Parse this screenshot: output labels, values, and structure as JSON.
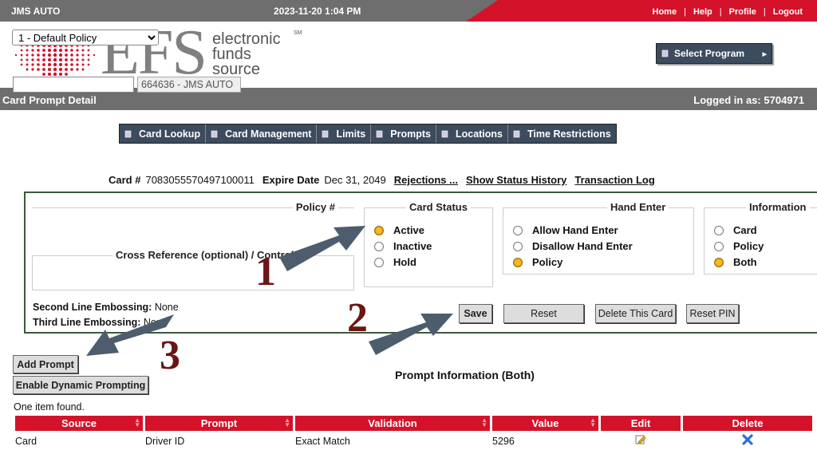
{
  "header": {
    "company": "JMS AUTO",
    "datetime": "2023-11-20 1:04 PM",
    "links": [
      "Home",
      "Help",
      "Profile",
      "Logout"
    ]
  },
  "logo": {
    "brand": "EFS",
    "tagline_line1": "electronic",
    "tagline_line2": "funds",
    "tagline_line3": "source",
    "sm": "SM",
    "brand_colors": {
      "gray": "#808080",
      "red": "#d4122a"
    }
  },
  "select_program_label": "Select Program",
  "titlebar": {
    "title": "Card Prompt Detail",
    "logged_in": "Logged in as: 5704971"
  },
  "nav": [
    "Card Lookup",
    "Card Management",
    "Limits",
    "Prompts",
    "Locations",
    "Time Restrictions"
  ],
  "card": {
    "card_label": "Card #",
    "card_number": "7083055570497100011",
    "expire_label": "Expire Date",
    "expire_date": "Dec 31, 2049",
    "links": [
      "Rejections ...",
      "Show Status History",
      "Transaction Log"
    ]
  },
  "policy": {
    "legend": "Policy #",
    "selected": "1 - Default Policy"
  },
  "cross_reference": {
    "legend": "Cross Reference (optional) / Control",
    "value": "",
    "readonly_value": "664636 - JMS AUTO"
  },
  "card_status": {
    "legend": "Card Status",
    "options": [
      "Active",
      "Inactive",
      "Hold"
    ],
    "selected": "Active"
  },
  "hand_enter": {
    "legend": "Hand Enter",
    "options": [
      "Allow Hand Enter",
      "Disallow Hand Enter",
      "Policy"
    ],
    "selected": "Policy"
  },
  "information": {
    "legend": "Information",
    "options": [
      "Card",
      "Policy",
      "Both"
    ],
    "selected": "Both"
  },
  "embossing": {
    "second_label": "Second Line Embossing:",
    "second_value": "None",
    "third_label": "Third Line Embossing:",
    "third_value": "None"
  },
  "buttons": {
    "save": "Save",
    "reset": "Reset",
    "delete_card": "Delete This Card",
    "reset_pin": "Reset PIN",
    "add_prompt": "Add Prompt",
    "dynamic": "Enable Dynamic Prompting"
  },
  "prompt_section": {
    "title": "Prompt Information (Both)",
    "found": "One item found."
  },
  "table": {
    "columns": [
      "Source",
      "Prompt",
      "Validation",
      "Value",
      "Edit",
      "Delete"
    ],
    "rows": [
      {
        "source": "Card",
        "prompt": "Driver ID",
        "validation": "Exact Match",
        "value": "5296"
      }
    ]
  },
  "annotations": [
    "1",
    "2",
    "3"
  ],
  "colors": {
    "accent_red": "#d4122a",
    "header_gray": "#6e6e6e",
    "nav_blue": "#3c4b5e",
    "arrow": "#4d5d6e",
    "annotation": "#6b1515",
    "radio_selected": "#f5b82a"
  }
}
